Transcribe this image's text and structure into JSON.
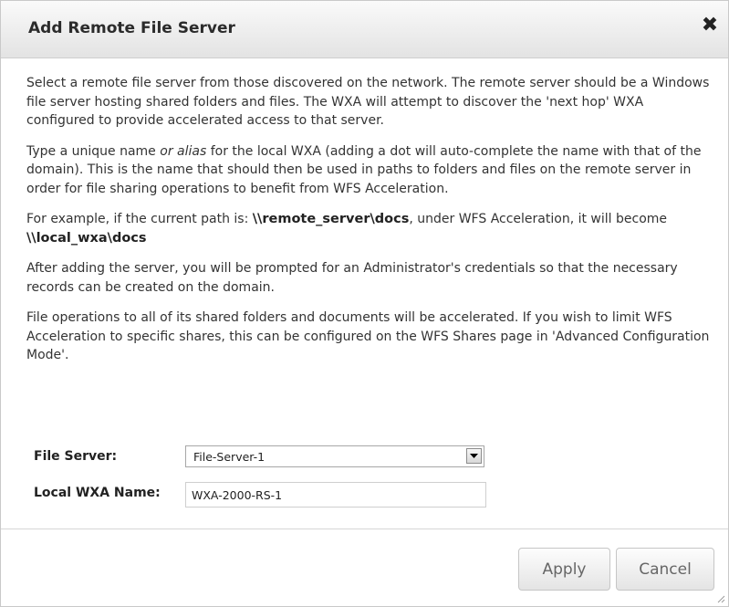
{
  "dialog": {
    "title": "Add Remote File Server",
    "close_symbol": "✖",
    "close_icon": "close-icon"
  },
  "body": {
    "p1": "Select a remote file server from those discovered on the network. The remote server should be a Windows file server hosting shared folders and files. The WXA will attempt to discover the 'next hop' WXA configured to provide accelerated access to that server.",
    "p2_before": "Type a unique name ",
    "p2_em": "or alias",
    "p2_after": " for the local WXA (adding a dot will auto-complete the name with that of the domain). This is the name that should then be used in paths to folders and files on the remote server in order for file sharing operations to benefit from WFS Acceleration.",
    "p3_before": "For example, if the current path is: ",
    "p3_path1": "\\\\remote_server\\docs",
    "p3_middle": ", under WFS Acceleration, it will become ",
    "p3_path2": "\\\\local_wxa\\docs",
    "p4": "After adding the server, you will be prompted for an Administrator's credentials so that the necessary records can be created on the domain.",
    "p5": "File operations to all of its shared folders and documents will be accelerated. If you wish to limit WFS Acceleration to specific shares, this can be configured on the WFS Shares page in 'Advanced Configuration Mode'."
  },
  "form": {
    "file_server_label": "File Server:",
    "file_server_value": "File-Server-1",
    "local_wxa_label": "Local WXA Name:",
    "local_wxa_value": "WXA-2000-RS-1"
  },
  "buttons": {
    "apply": "Apply",
    "cancel": "Cancel"
  }
}
